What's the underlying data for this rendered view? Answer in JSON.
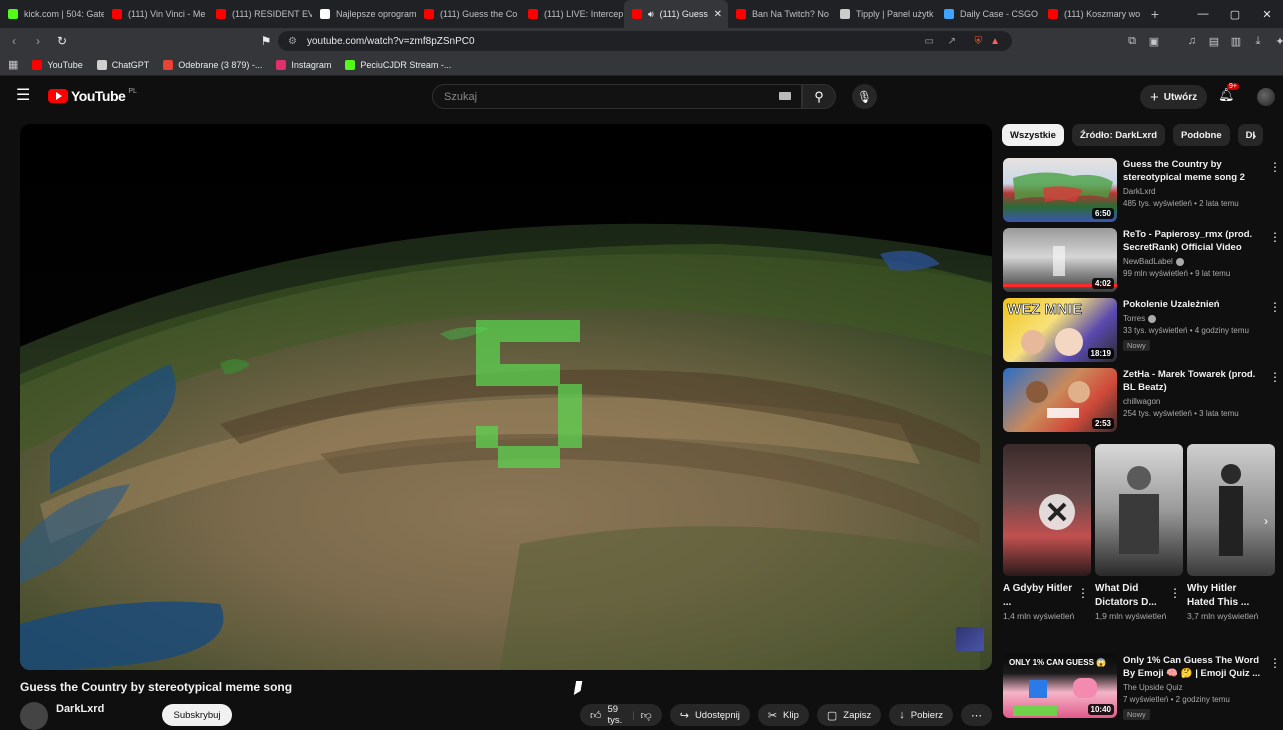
{
  "browser": {
    "tabs": [
      {
        "title": "kick.com | 504: Gate",
        "fav": "#53fc18",
        "active": false
      },
      {
        "title": "(111) Vin Vinci - Me",
        "fav": "#ff0000",
        "active": false
      },
      {
        "title": "(111) RESIDENT EVI",
        "fav": "#ff0000",
        "active": false
      },
      {
        "title": "Najlepsze oprogram",
        "fav": "#ffffff",
        "active": false
      },
      {
        "title": "(111) Guess the Co",
        "fav": "#ff0000",
        "active": false
      },
      {
        "title": "(111) LIVE: Intercep",
        "fav": "#ff0000",
        "active": false
      },
      {
        "title": "(111) Guess",
        "fav": "#ff0000",
        "active": true
      },
      {
        "title": "Ban Na Twitch? No",
        "fav": "#ff0000",
        "active": false
      },
      {
        "title": "Tipply | Panel użytk",
        "fav": "#cccccc",
        "active": false
      },
      {
        "title": "Daily Case - CSGO",
        "fav": "#3ea6ff",
        "active": false
      },
      {
        "title": "(111) Koszmary wo",
        "fav": "#ff0000",
        "active": false
      }
    ],
    "new_tab": "+",
    "url": "youtube.com/watch?v=zmf8pZSnPC0",
    "bookmarks": [
      {
        "label": "YouTube",
        "color": "#ff0000"
      },
      {
        "label": "ChatGPT",
        "color": "#d0d0d0"
      },
      {
        "label": "Odebrane (3 879) -...",
        "color": "#ea4335"
      },
      {
        "label": "Instagram",
        "color": "#e1306c"
      },
      {
        "label": "PeciuCJDR Stream -...",
        "color": "#53fc18"
      }
    ]
  },
  "youtube": {
    "logo": "YouTube",
    "country": "PL",
    "search_placeholder": "Szukaj",
    "create_label": "Utwórz",
    "notifications_badge": "9+"
  },
  "video": {
    "countdown_digit": "5",
    "title": "Guess the Country by stereotypical meme song",
    "channel": "DarkLxrd",
    "subscribe_label": "Subskrybuj",
    "likes": "59 tys.",
    "share": "Udostępnij",
    "clip": "Klip",
    "save": "Zapisz",
    "download": "Pobierz"
  },
  "chips": [
    {
      "label": "Wszystkie",
      "selected": true
    },
    {
      "label": "Źródło: DarkLxrd",
      "selected": false
    },
    {
      "label": "Podobne",
      "selected": false
    },
    {
      "label": "Dl",
      "selected": false
    }
  ],
  "recommendations": [
    {
      "title": "Guess the Country by stereotypical meme song 2",
      "channel": "DarkLxrd",
      "meta": "485 tys. wyświetleń • 2 lata temu",
      "duration": "6:50",
      "new": "",
      "verified": false
    },
    {
      "title": "ReTo - Papierosy_rmx (prod. SecretRank) Official Video",
      "channel": "NewBadLabel",
      "meta": "99 mln wyświetleń • 9 lat temu",
      "duration": "4:02",
      "new": "",
      "verified": true
    },
    {
      "title": "Pokolenie Uzależnień",
      "channel": "Torres",
      "meta": "33 tys. wyświetleń • 4 godziny temu",
      "duration": "18:19",
      "new": "Nowy",
      "verified": true
    },
    {
      "title": "ZetHa - Marek Towarek (prod. BL Beatz)",
      "channel": "chillwagon",
      "meta": "254 tys. wyświetleń • 3 lata temu",
      "duration": "2:53",
      "new": "",
      "verified": false
    }
  ],
  "shorts": [
    {
      "title": "A Gdyby Hitler ...",
      "views": "1,4 mln wyświetleń"
    },
    {
      "title": "What Did Dictators D...",
      "views": "1,9 mln wyświetleń"
    },
    {
      "title": "Why Hitler Hated This ...",
      "views": "3,7 mln wyświetleń"
    }
  ],
  "bottom_reco": {
    "title": "Only 1% Can Guess The Word By Emoji 🧠 🤔 | Emoji Quiz ...",
    "channel": "The Upside Quiz",
    "meta": "7 wyświetleń • 2 godziny temu",
    "duration": "10:40",
    "new": "Nowy",
    "thumb_text": "ONLY 1% CAN GUESS 😱"
  }
}
